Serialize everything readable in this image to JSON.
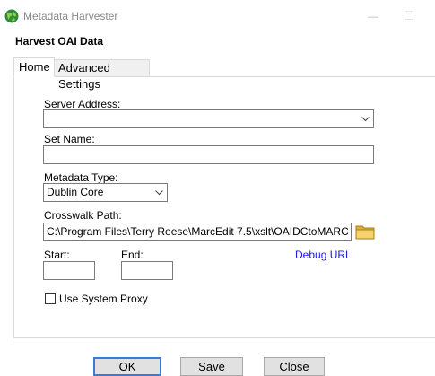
{
  "window": {
    "title": "Metadata Harvester",
    "minimize_glyph": "—"
  },
  "header": {
    "title": "Harvest OAI Data"
  },
  "tabs": [
    {
      "label": "Home",
      "active": true
    },
    {
      "label": "Advanced Settings",
      "active": false
    }
  ],
  "form": {
    "server_address_label": "Server Address:",
    "server_address_value": "",
    "set_name_label": "Set Name:",
    "set_name_value": "",
    "metadata_type_label": "Metadata Type:",
    "metadata_type_value": "Dublin Core",
    "crosswalk_path_label": "Crosswalk Path:",
    "crosswalk_path_value": "C:\\Program Files\\Terry Reese\\MarcEdit 7.5\\xslt\\OAIDCtoMARC",
    "start_label": "Start:",
    "start_value": "",
    "end_label": "End:",
    "end_value": "",
    "debug_url_label": "Debug URL",
    "use_proxy_label": "Use System Proxy",
    "use_proxy_checked": false
  },
  "buttons": {
    "ok": "OK",
    "save": "Save",
    "close": "Close"
  },
  "colors": {
    "link": "#1a1ae0",
    "primary_button_border": "#3a7ad8",
    "folder": "#f2c94c"
  }
}
